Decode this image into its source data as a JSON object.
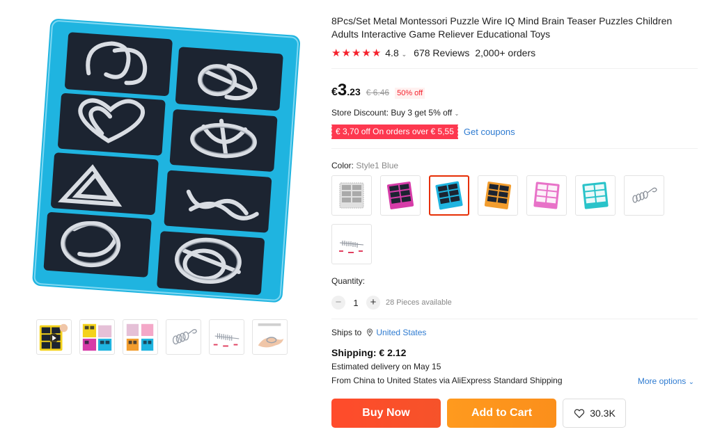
{
  "product": {
    "title": "8Pcs/Set Metal Montessori Puzzle Wire IQ Mind Brain Teaser Puzzles Children Adults Interactive Game Reliever Educational Toys",
    "rating": "4.8",
    "stars": 5,
    "reviews": "678 Reviews",
    "orders": "2,000+ orders"
  },
  "price": {
    "currency": "€",
    "integer": "3",
    "decimal": ".23",
    "original": "€ 6.46",
    "discount": "50% off"
  },
  "store_discount": "Store Discount: Buy 3 get 5% off",
  "coupon": {
    "tag": "€ 3,70 off On orders over € 5,55",
    "link": "Get coupons"
  },
  "color": {
    "label": "Color:",
    "value": "Style1 Blue",
    "options": [
      "Style gray",
      "Style pink",
      "Style1 Blue",
      "Style orange",
      "Style purple",
      "Style teal",
      "Style spiral",
      "Style rod"
    ]
  },
  "quantity": {
    "label": "Quantity:",
    "value": "1",
    "minus": "−",
    "plus": "+",
    "available": "28 Pieces available"
  },
  "shipping": {
    "ships_to_label": "Ships to",
    "destination": "United States",
    "cost": "Shipping: € 2.12",
    "estimate": "Estimated delivery on May 15",
    "route": "From China to United States via AliExpress Standard Shipping",
    "more_options": "More options"
  },
  "actions": {
    "buy_now": "Buy Now",
    "add_to_cart": "Add to Cart",
    "wishlist_count": "30.3K"
  },
  "colors": {
    "accent_red": "#f5222d",
    "buy_button": "#ff4b2b",
    "cart_button": "#ff9a1e",
    "link_blue": "#2e7bd1",
    "board_blue": "#1fb4e0"
  }
}
